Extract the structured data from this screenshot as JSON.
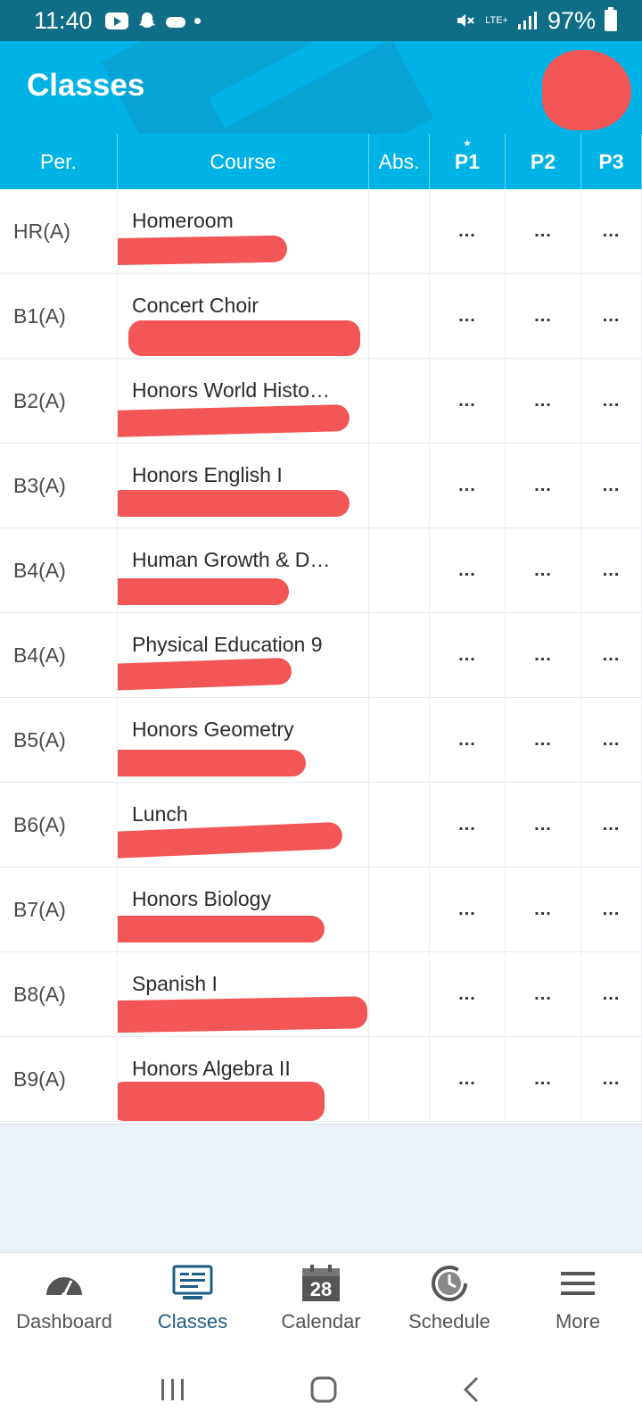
{
  "status_bar": {
    "time": "11:40",
    "network": "LTE+",
    "battery": "97%",
    "icons": [
      "youtube-icon",
      "snapchat-icon",
      "cloud-icon",
      "dot-icon",
      "mute-icon",
      "signal-icon",
      "battery-icon"
    ]
  },
  "app_bar": {
    "title": "Classes"
  },
  "table": {
    "headers": {
      "period": "Per.",
      "course": "Course",
      "absences": "Abs.",
      "p1": "P1",
      "p2": "P2",
      "p3": "P3"
    },
    "rows": [
      {
        "period": "HR(A)",
        "course": "Homeroom",
        "absences": "",
        "p1": "...",
        "p2": "...",
        "p3": "..."
      },
      {
        "period": "B1(A)",
        "course": "Concert Choir",
        "absences": "",
        "p1": "...",
        "p2": "...",
        "p3": "..."
      },
      {
        "period": "B2(A)",
        "course": "Honors World Histo…",
        "absences": "",
        "p1": "...",
        "p2": "...",
        "p3": "..."
      },
      {
        "period": "B3(A)",
        "course": "Honors English I",
        "absences": "",
        "p1": "...",
        "p2": "...",
        "p3": "..."
      },
      {
        "period": "B4(A)",
        "course": "Human Growth & D…",
        "absences": "",
        "p1": "...",
        "p2": "...",
        "p3": "..."
      },
      {
        "period": "B4(A)",
        "course": "Physical Education 9",
        "absences": "",
        "p1": "...",
        "p2": "...",
        "p3": "..."
      },
      {
        "period": "B5(A)",
        "course": "Honors Geometry",
        "absences": "",
        "p1": "...",
        "p2": "...",
        "p3": "..."
      },
      {
        "period": "B6(A)",
        "course": "Lunch",
        "absences": "",
        "p1": "...",
        "p2": "...",
        "p3": "..."
      },
      {
        "period": "B7(A)",
        "course": "Honors Biology",
        "absences": "",
        "p1": "...",
        "p2": "...",
        "p3": "..."
      },
      {
        "period": "B8(A)",
        "course": "Spanish I",
        "absences": "",
        "p1": "...",
        "p2": "...",
        "p3": "..."
      },
      {
        "period": "B9(A)",
        "course": "Honors Algebra II",
        "absences": "",
        "p1": "...",
        "p2": "...",
        "p3": "..."
      }
    ]
  },
  "bottom_nav": {
    "items": [
      {
        "label": "Dashboard",
        "icon": "gauge-icon"
      },
      {
        "label": "Classes",
        "icon": "classes-icon",
        "active": true
      },
      {
        "label": "Calendar",
        "icon": "calendar-icon",
        "day": "28"
      },
      {
        "label": "Schedule",
        "icon": "clock-icon"
      },
      {
        "label": "More",
        "icon": "menu-icon"
      }
    ]
  },
  "colors": {
    "status_bar": "#0f6e86",
    "app_bar": "#00b3e6",
    "active_nav": "#1e5e86",
    "redaction": "#f25656"
  }
}
